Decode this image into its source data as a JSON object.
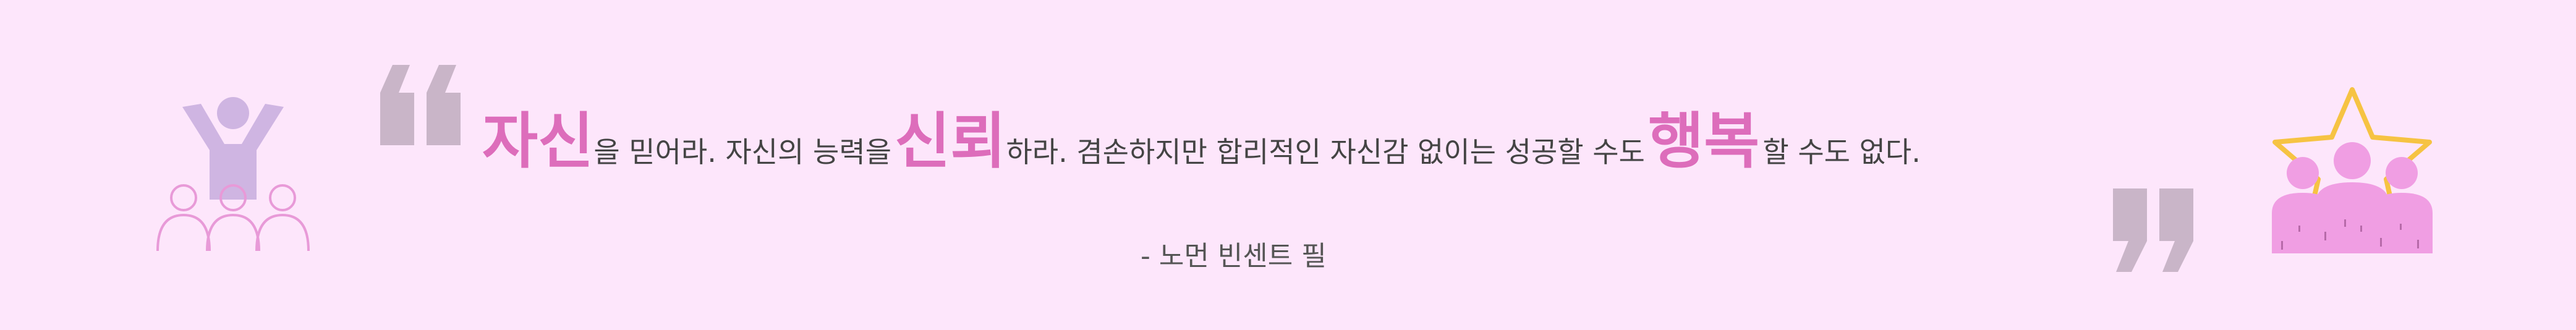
{
  "quote": {
    "part1_accent": "자신",
    "part2": "을 믿어라.  자신의 능력을",
    "part3_accent": "신뢰",
    "part4": "하라.  겸손하지만 합리적인 자신감 없이는 성공할 수도",
    "part5_accent": "행복",
    "part6": "할 수도 없다.",
    "attribution": "- 노먼 빈센트 필"
  },
  "colors": {
    "background": "#fde6fb",
    "accent": "#dd6dbb",
    "quote_mark": "#c9b5c8",
    "leader_figure": "#cfb5e2",
    "team_figure": "#f09ee3",
    "star_outline": "#f6c343"
  },
  "icons": {
    "left": "leader-with-team-icon",
    "open_quote": "open-quote-icon",
    "close_quote": "close-quote-icon",
    "right": "team-star-icon"
  }
}
